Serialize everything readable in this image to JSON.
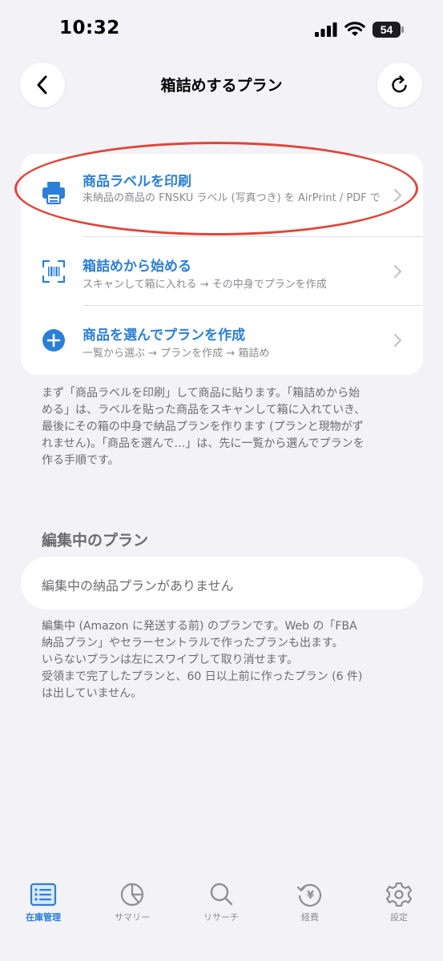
{
  "status_bar": {
    "time": "10:32",
    "battery": "54"
  },
  "header": {
    "title": "箱詰めするプラン"
  },
  "actions": [
    {
      "title": "商品ラベルを印刷",
      "subtitle": "未納品の商品の FNSKU ラベル (写真つき) を AirPrint / PDF で",
      "icon": "printer-icon"
    },
    {
      "title": "箱詰めから始める",
      "subtitle": "スキャンして箱に入れる → その中身でプランを作成",
      "icon": "barcode-scan-icon"
    },
    {
      "title": "商品を選んでプランを作成",
      "subtitle": "一覧から選ぶ → プランを作成 → 箱詰め",
      "icon": "plus-circle-icon"
    }
  ],
  "actions_footnote": [
    "まず「商品ラベルを印刷」して商品に貼ります。「箱詰めから始",
    "める」は、ラベルを貼った商品をスキャンして箱に入れていき、",
    "最後にその箱の中身で納品プランを作ります (プランと現物がず",
    "れません)。「商品を選んで…」は、先に一覧から選んでプランを",
    "作る手順です。"
  ],
  "drafts": {
    "header": "編集中のプラン",
    "empty_text": "編集中の納品プランがありません",
    "footnote": [
      "編集中 (Amazon に発送する前) のプランです。Web の「FBA",
      "納品プラン」やセラーセントラルで作ったプランも出ます。",
      "いらないプランは左にスワイプして取り消せます。",
      "受領まで完了したプランと、60 日以上前に作ったプラン (6 件)",
      "は出していません。"
    ]
  },
  "tabs": [
    {
      "label": "在庫管理",
      "icon": "inventory-list-icon",
      "active": true
    },
    {
      "label": "サマリー",
      "icon": "pie-chart-icon",
      "active": false
    },
    {
      "label": "リサーチ",
      "icon": "search-icon",
      "active": false
    },
    {
      "label": "経費",
      "icon": "yen-history-icon",
      "active": false
    },
    {
      "label": "設定",
      "icon": "gear-icon",
      "active": false
    }
  ],
  "colors": {
    "accent": "#2b7fd8",
    "annotation": "#e0453a",
    "background": "#f2f2f7"
  }
}
